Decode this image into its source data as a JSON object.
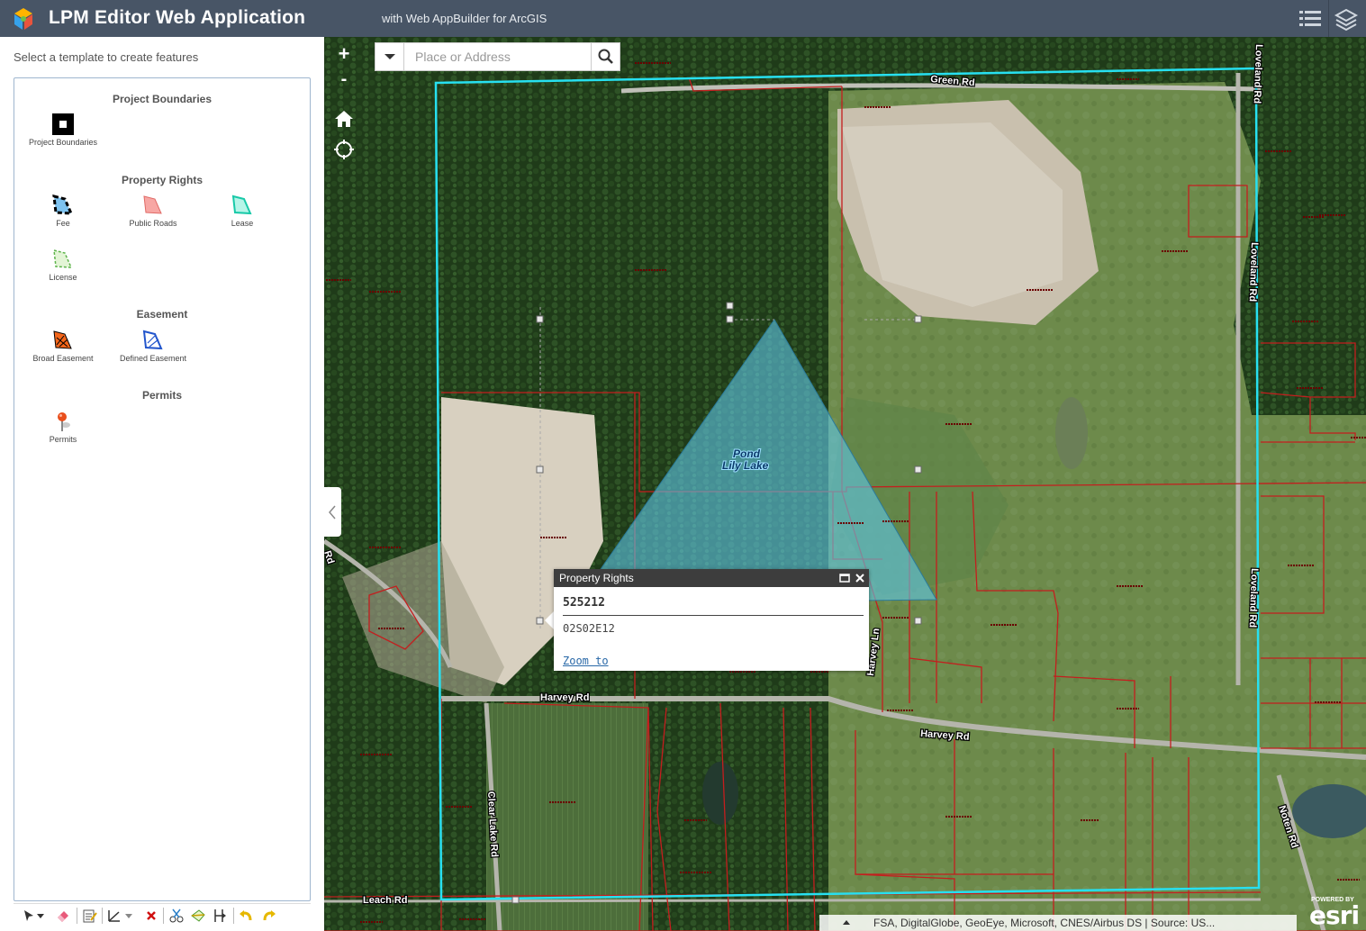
{
  "header": {
    "title": "LPM Editor Web Application",
    "subtitle": "with Web AppBuilder for ArcGIS",
    "icons": [
      "app-logo-icon",
      "attribute-table-icon",
      "layers-icon"
    ]
  },
  "panel": {
    "hint": "Select a template to create features",
    "groups": [
      {
        "title": "Project Boundaries",
        "items": [
          {
            "label": "Project Boundaries",
            "icon": "project-boundary-symbol-icon"
          }
        ]
      },
      {
        "title": "Property Rights",
        "items": [
          {
            "label": "Fee",
            "icon": "fee-symbol-icon"
          },
          {
            "label": "Public Roads",
            "icon": "public-roads-symbol-icon"
          },
          {
            "label": "Lease",
            "icon": "lease-symbol-icon"
          },
          {
            "label": "License",
            "icon": "license-symbol-icon"
          }
        ]
      },
      {
        "title": "Easement",
        "items": [
          {
            "label": "Broad Easement",
            "icon": "broad-easement-symbol-icon"
          },
          {
            "label": "Defined Easement",
            "icon": "defined-easement-symbol-icon"
          }
        ]
      },
      {
        "title": "Permits",
        "items": [
          {
            "label": "Permits",
            "icon": "permit-pin-icon"
          }
        ]
      }
    ]
  },
  "map": {
    "zoom_in": "+",
    "zoom_out": "-",
    "search_placeholder": "Place or Address",
    "road_labels": [
      "Green Rd",
      "Harvey Rd",
      "Harvey Rd",
      "Harvey Ln",
      "Clear Lake Rd",
      "Loveland Rd",
      "Loveland Rd",
      "Loveland Rd",
      "Noten Rd",
      "Leach Rd",
      "Rd"
    ],
    "water_label_line1": "Pond",
    "water_label_line2": "Lily Lake",
    "attribution": "FSA, DigitalGlobe, GeoEye, Microsoft, CNES/Airbus DS | Source: US...",
    "esri_powered": "POWERED BY",
    "esri_logo": "esri",
    "colors": {
      "boundary": "#27e0f0",
      "parcel": "#c41e1e",
      "selection_fill": "#5fc8e8"
    }
  },
  "popup": {
    "header": "Property Rights",
    "title": "525212",
    "value": "02S02E12",
    "link": "Zoom to"
  }
}
